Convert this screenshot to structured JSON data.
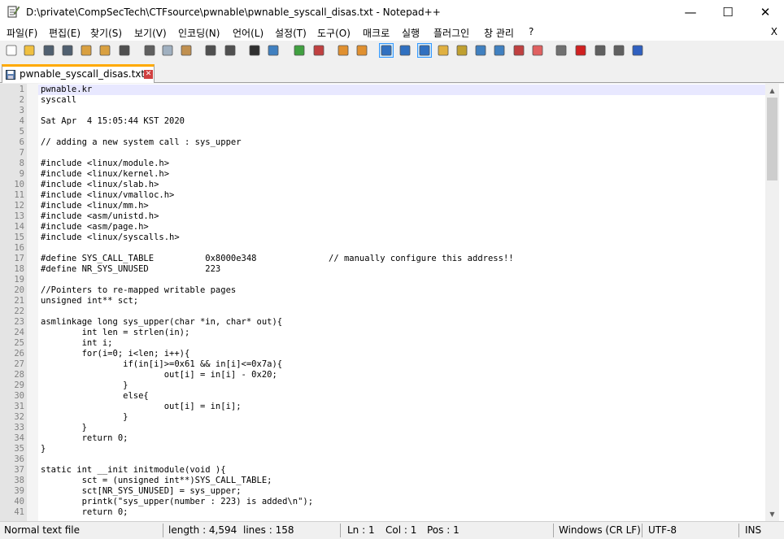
{
  "window": {
    "title": "D:\\private\\CompSecTech\\CTFsource\\pwnable\\pwnable_syscall_disas.txt - Notepad++",
    "minimize_glyph": "—",
    "maximize_glyph": "☐",
    "close_glyph": "✕",
    "app_icon": "notepad-icon"
  },
  "menu": {
    "items": [
      "파일(F)",
      "편집(E)",
      "찾기(S)",
      "보기(V)",
      "인코딩(N)",
      "언어(L)",
      "설정(T)",
      "도구(O)",
      "매크로",
      "실행",
      "플러그인",
      "창 관리",
      "?"
    ],
    "close_label": "X"
  },
  "toolbar": {
    "buttons": [
      {
        "name": "new-file-icon",
        "color": "#ffffff"
      },
      {
        "name": "open-file-icon",
        "color": "#f0c040"
      },
      {
        "name": "save-icon",
        "color": "#506070"
      },
      {
        "name": "save-all-icon",
        "color": "#506070"
      },
      {
        "name": "close-icon",
        "color": "#d9a040"
      },
      {
        "name": "close-all-icon",
        "color": "#d9a040"
      },
      {
        "name": "print-icon",
        "color": "#505050"
      },
      {
        "name": "cut-icon",
        "color": "#606060"
      },
      {
        "name": "copy-icon",
        "color": "#a0b0c0"
      },
      {
        "name": "paste-icon",
        "color": "#c09050"
      },
      {
        "name": "undo-icon",
        "color": "#505050"
      },
      {
        "name": "redo-icon",
        "color": "#505050"
      },
      {
        "name": "find-icon",
        "color": "#303030"
      },
      {
        "name": "replace-icon",
        "color": "#4080c0"
      },
      {
        "name": "zoom-in-icon",
        "color": "#40a040"
      },
      {
        "name": "zoom-out-icon",
        "color": "#c04040"
      },
      {
        "name": "sync-vertical-icon",
        "color": "#e09030"
      },
      {
        "name": "sync-horizontal-icon",
        "color": "#e09030"
      },
      {
        "name": "word-wrap-icon",
        "color": "#3070c0"
      },
      {
        "name": "show-all-chars-icon",
        "color": "#3070c0"
      },
      {
        "name": "indent-guide-icon",
        "color": "#3070c0"
      },
      {
        "name": "udl-icon",
        "color": "#e0b040"
      },
      {
        "name": "doc-map-icon",
        "color": "#c0a030"
      },
      {
        "name": "doc-list-icon",
        "color": "#4080c0"
      },
      {
        "name": "function-list-icon",
        "color": "#4080c0"
      },
      {
        "name": "folder-workspace-icon",
        "color": "#c04040"
      },
      {
        "name": "monitor-icon",
        "color": "#e06060"
      },
      {
        "name": "eye-icon",
        "color": "#707070"
      },
      {
        "name": "record-macro-icon",
        "color": "#d02020"
      },
      {
        "name": "stop-macro-icon",
        "color": "#606060"
      },
      {
        "name": "play-macro-icon",
        "color": "#606060"
      },
      {
        "name": "run-macro-multiple-icon",
        "color": "#3060c0"
      },
      {
        "name": "save-macro-icon",
        "color": "#606060"
      }
    ]
  },
  "tab": {
    "label": "pwnable_syscall_disas.txt",
    "close_glyph": "✕",
    "accent": "#ffaa00"
  },
  "editor": {
    "lines": [
      {
        "n": "1",
        "text": "pwnable.kr"
      },
      {
        "n": "2",
        "text": "syscall"
      },
      {
        "n": "3",
        "text": ""
      },
      {
        "n": "4",
        "text": "Sat Apr  4 15:05:44 KST 2020"
      },
      {
        "n": "5",
        "text": ""
      },
      {
        "n": "6",
        "text": "// adding a new system call : sys_upper"
      },
      {
        "n": "7",
        "text": ""
      },
      {
        "n": "8",
        "text": "#include <linux/module.h>"
      },
      {
        "n": "9",
        "text": "#include <linux/kernel.h>"
      },
      {
        "n": "10",
        "text": "#include <linux/slab.h>"
      },
      {
        "n": "11",
        "text": "#include <linux/vmalloc.h>"
      },
      {
        "n": "12",
        "text": "#include <linux/mm.h>"
      },
      {
        "n": "13",
        "text": "#include <asm/unistd.h>"
      },
      {
        "n": "14",
        "text": "#include <asm/page.h>"
      },
      {
        "n": "15",
        "text": "#include <linux/syscalls.h>"
      },
      {
        "n": "16",
        "text": ""
      },
      {
        "n": "17",
        "text": "#define SYS_CALL_TABLE          0x8000e348              // manually configure this address!!"
      },
      {
        "n": "18",
        "text": "#define NR_SYS_UNUSED           223"
      },
      {
        "n": "19",
        "text": ""
      },
      {
        "n": "20",
        "text": "//Pointers to re-mapped writable pages"
      },
      {
        "n": "21",
        "text": "unsigned int** sct;"
      },
      {
        "n": "22",
        "text": ""
      },
      {
        "n": "23",
        "text": "asmlinkage long sys_upper(char *in, char* out){"
      },
      {
        "n": "24",
        "text": "        int len = strlen(in);"
      },
      {
        "n": "25",
        "text": "        int i;"
      },
      {
        "n": "26",
        "text": "        for(i=0; i<len; i++){"
      },
      {
        "n": "27",
        "text": "                if(in[i]>=0x61 && in[i]<=0x7a){"
      },
      {
        "n": "28",
        "text": "                        out[i] = in[i] - 0x20;"
      },
      {
        "n": "29",
        "text": "                }"
      },
      {
        "n": "30",
        "text": "                else{"
      },
      {
        "n": "31",
        "text": "                        out[i] = in[i];"
      },
      {
        "n": "32",
        "text": "                }"
      },
      {
        "n": "33",
        "text": "        }"
      },
      {
        "n": "34",
        "text": "        return 0;"
      },
      {
        "n": "35",
        "text": "}"
      },
      {
        "n": "36",
        "text": ""
      },
      {
        "n": "37",
        "text": "static int __init initmodule(void ){"
      },
      {
        "n": "38",
        "text": "        sct = (unsigned int**)SYS_CALL_TABLE;"
      },
      {
        "n": "39",
        "text": "        sct[NR_SYS_UNUSED] = sys_upper;"
      },
      {
        "n": "40",
        "text": "        printk(\"sys_upper(number : 223) is added\\n\");"
      },
      {
        "n": "41",
        "text": "        return 0;"
      }
    ]
  },
  "statusbar": {
    "file_type": "Normal text file",
    "length": "length : 4,594",
    "lines": "lines : 158",
    "ln": "Ln : 1",
    "col": "Col : 1",
    "pos": "Pos : 1",
    "eol": "Windows (CR LF)",
    "encoding": "UTF-8",
    "mode": "INS"
  }
}
